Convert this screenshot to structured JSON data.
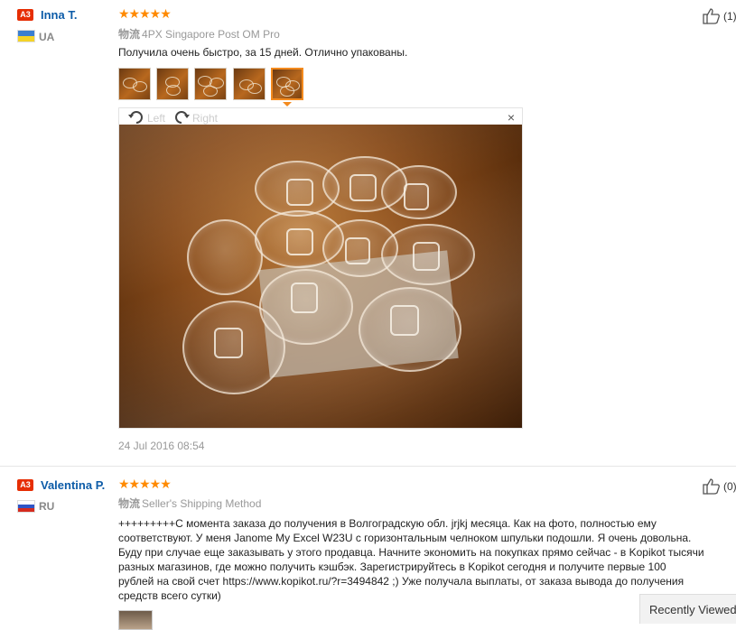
{
  "reviews": [
    {
      "badge": "A3",
      "name": "Inna T.",
      "country": "UA",
      "stars": "★★★★★",
      "ship_prefix": "物流",
      "shipping": "4PX Singapore Post OM Pro",
      "text": "Получила очень быстро, за 15 дней. Отлично упакованы.",
      "likes": "(1)",
      "date": "24 Jul 2016 08:54",
      "viewer": {
        "left": "Left",
        "right": "Right",
        "close": "×"
      }
    },
    {
      "badge": "A3",
      "name": "Valentina P.",
      "country": "RU",
      "stars": "★★★★★",
      "ship_prefix": "物流",
      "shipping": "Seller's Shipping Method",
      "text_lines": [
        "+++++++++С момента заказа до получения в Волгоградскую обл. jrjkj месяца. Как на фото, полностью ему",
        "соответствуют. У меня Janome My Excel W23U с горизонтальным челноком шпульки подошли. Я очень довольна.",
        "Буду при случае еще заказывать у этого продавца. Начните экономить на покупках прямо сейчас - в Kopikot тысячи",
        "разных магазинов, где можно получить кэшбэк. Зарегистрируйтесь в Kopikot сегодня и получите первые 100",
        "рублей на свой счет https://www.kopikot.ru/?r=3494842 ;) Уже получала выплаты, от заказа вывода до получения",
        "средств всего сутки)"
      ],
      "likes": "(0)"
    }
  ],
  "recently_viewed": "Recently Viewed",
  "icons": {
    "like": "thumbs-up-icon",
    "rotate_left": "rotate-left-icon",
    "rotate_right": "rotate-right-icon",
    "close": "close-icon"
  },
  "colors": {
    "accent": "#f38a1e",
    "name": "#0d5ca8",
    "badge": "#e62e04",
    "star": "#ff8a00"
  }
}
